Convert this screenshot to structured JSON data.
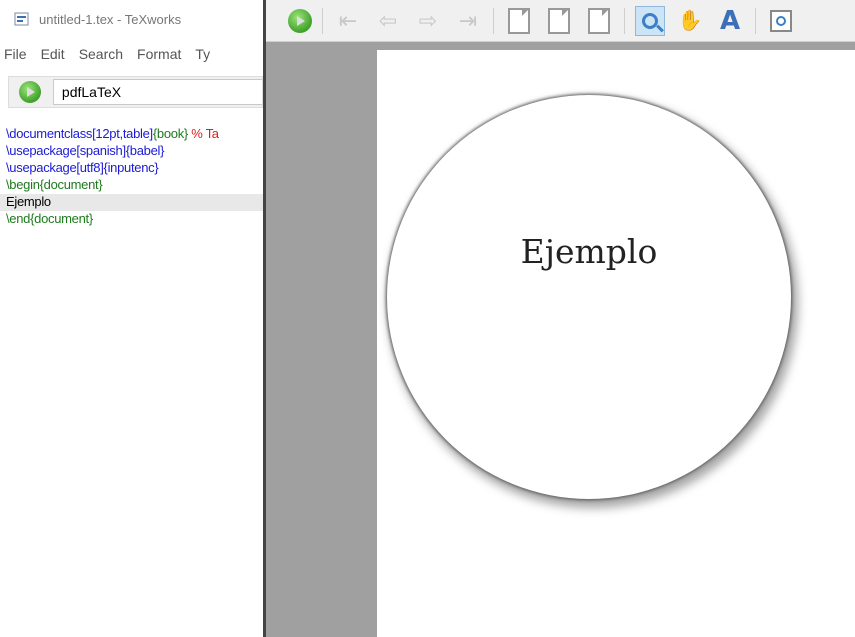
{
  "editor": {
    "window_title": "untitled-1.tex - TeXworks",
    "menu": [
      "File",
      "Edit",
      "Search",
      "Format",
      "Ty"
    ],
    "engine": "pdfLaTeX",
    "code_lines": [
      {
        "segments": [
          {
            "text": "\\documentclass",
            "color": "blue"
          },
          {
            "text": "[12pt,table]",
            "color": "blue"
          },
          {
            "text": "{book}",
            "color": "green"
          },
          {
            "text": " % Ta",
            "color": "red"
          }
        ]
      },
      {
        "segments": [
          {
            "text": "\\usepackage",
            "color": "blue"
          },
          {
            "text": "[spanish]",
            "color": "blue"
          },
          {
            "text": "{babel}",
            "color": "blue"
          }
        ]
      },
      {
        "segments": [
          {
            "text": "\\usepackage",
            "color": "blue"
          },
          {
            "text": "[utf8]",
            "color": "blue"
          },
          {
            "text": "{inputenc}",
            "color": "blue"
          }
        ]
      },
      {
        "segments": [
          {
            "text": "\\begin",
            "color": "green"
          },
          {
            "text": "{document}",
            "color": "green"
          }
        ]
      },
      {
        "segments": [
          {
            "text": "Ejemplo",
            "color": "black"
          }
        ],
        "current": true
      },
      {
        "segments": [
          {
            "text": "\\end",
            "color": "green"
          },
          {
            "text": "{document}",
            "color": "green"
          }
        ]
      }
    ]
  },
  "preview": {
    "magnified_text": "Ejemplo"
  },
  "icons": [
    "typeset-icon",
    "first-page-icon",
    "previous-page-icon",
    "next-page-icon",
    "last-page-icon",
    "actual-size-icon",
    "fit-width-icon",
    "fit-window-icon",
    "magnify-tool-icon",
    "scroll-tool-icon",
    "select-text-icon",
    "zoom-box-icon"
  ],
  "colors": {
    "keyword_blue": "#1a1ad6",
    "brace_green": "#1e7a1e",
    "comment_red": "#e01b1b",
    "viewport_gray": "#a0a0a0"
  }
}
